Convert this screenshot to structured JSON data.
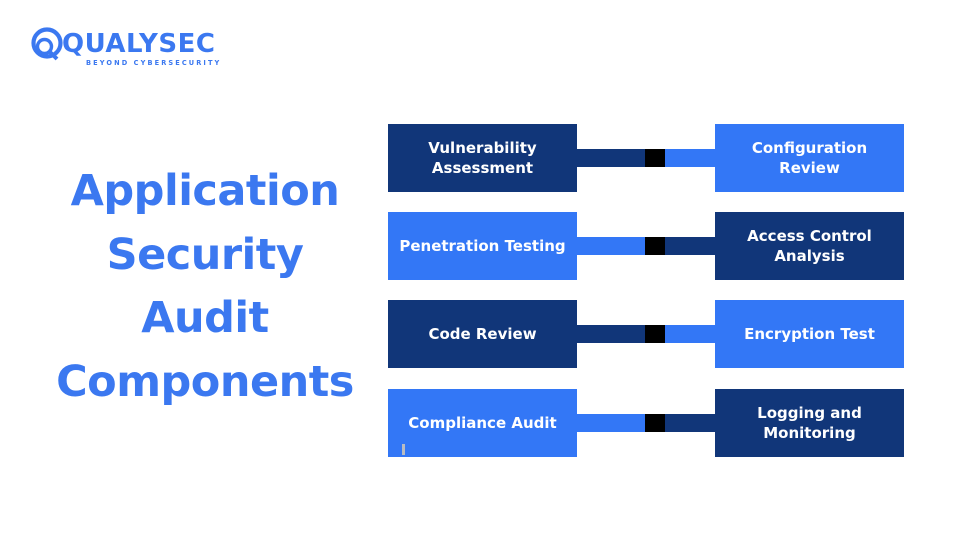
{
  "brand": {
    "logo_name": "QUALYSEC",
    "logo_tagline": "BEYOND CYBERSECURITY",
    "logo_color": "#3b78f0"
  },
  "headline": {
    "lines": [
      "Application",
      "Security",
      "Audit",
      "Components"
    ],
    "color": "#3b78f0"
  },
  "colors": {
    "dark_navy": "#113679",
    "bright_blue": "#3377f6",
    "knot_black": "#000000",
    "text_white": "#ffffff",
    "background": "#ffffff"
  },
  "diagram": {
    "type": "paired-rows",
    "rows": [
      {
        "left": {
          "label": "Vulnerability Assessment",
          "color": "#113679"
        },
        "right": {
          "label": "Configuration Review",
          "color": "#3377f6"
        }
      },
      {
        "left": {
          "label": "Penetration Testing",
          "color": "#3377f6"
        },
        "right": {
          "label": "Access Control Analysis",
          "color": "#113679"
        }
      },
      {
        "left": {
          "label": "Code Review",
          "color": "#113679"
        },
        "right": {
          "label": "Encryption Test",
          "color": "#3377f6"
        }
      },
      {
        "left": {
          "label": "Compliance Audit",
          "color": "#3377f6"
        },
        "right": {
          "label": "Logging and Monitoring",
          "color": "#113679"
        }
      }
    ]
  }
}
